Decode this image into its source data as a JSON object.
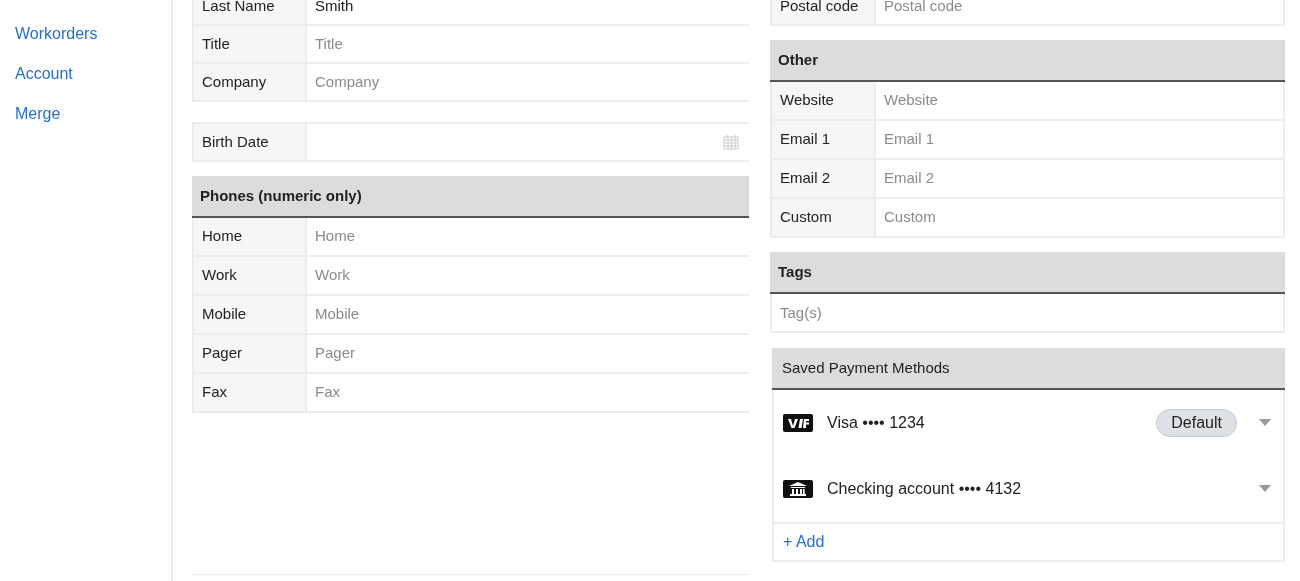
{
  "sidebar": {
    "items": [
      {
        "label": "Workorders"
      },
      {
        "label": "Account"
      },
      {
        "label": "Merge"
      }
    ]
  },
  "name_fields": [
    {
      "label": "Last Name",
      "value": "Smith"
    },
    {
      "label": "Title",
      "placeholder": "Title"
    },
    {
      "label": "Company",
      "placeholder": "Company"
    }
  ],
  "birth_date": {
    "label": "Birth Date"
  },
  "phones": {
    "title": "Phones (numeric only)",
    "fields": [
      {
        "label": "Home",
        "placeholder": "Home"
      },
      {
        "label": "Work",
        "placeholder": "Work"
      },
      {
        "label": "Mobile",
        "placeholder": "Mobile"
      },
      {
        "label": "Pager",
        "placeholder": "Pager"
      },
      {
        "label": "Fax",
        "placeholder": "Fax"
      }
    ]
  },
  "address_fields": [
    {
      "label": "Postal code",
      "placeholder": "Postal code"
    }
  ],
  "other": {
    "title": "Other",
    "fields": [
      {
        "label": "Website",
        "placeholder": "Website"
      },
      {
        "label": "Email 1",
        "placeholder": "Email 1"
      },
      {
        "label": "Email 2",
        "placeholder": "Email 2"
      },
      {
        "label": "Custom",
        "placeholder": "Custom"
      }
    ]
  },
  "tags": {
    "title": "Tags",
    "placeholder": "Tag(s)"
  },
  "payments": {
    "title": "Saved Payment Methods",
    "methods": [
      {
        "kind": "card",
        "label": "Visa •••• 1234",
        "badge": "Default"
      },
      {
        "kind": "bank",
        "label": "Checking account •••• 4132"
      }
    ],
    "add_link": "+ Add"
  }
}
